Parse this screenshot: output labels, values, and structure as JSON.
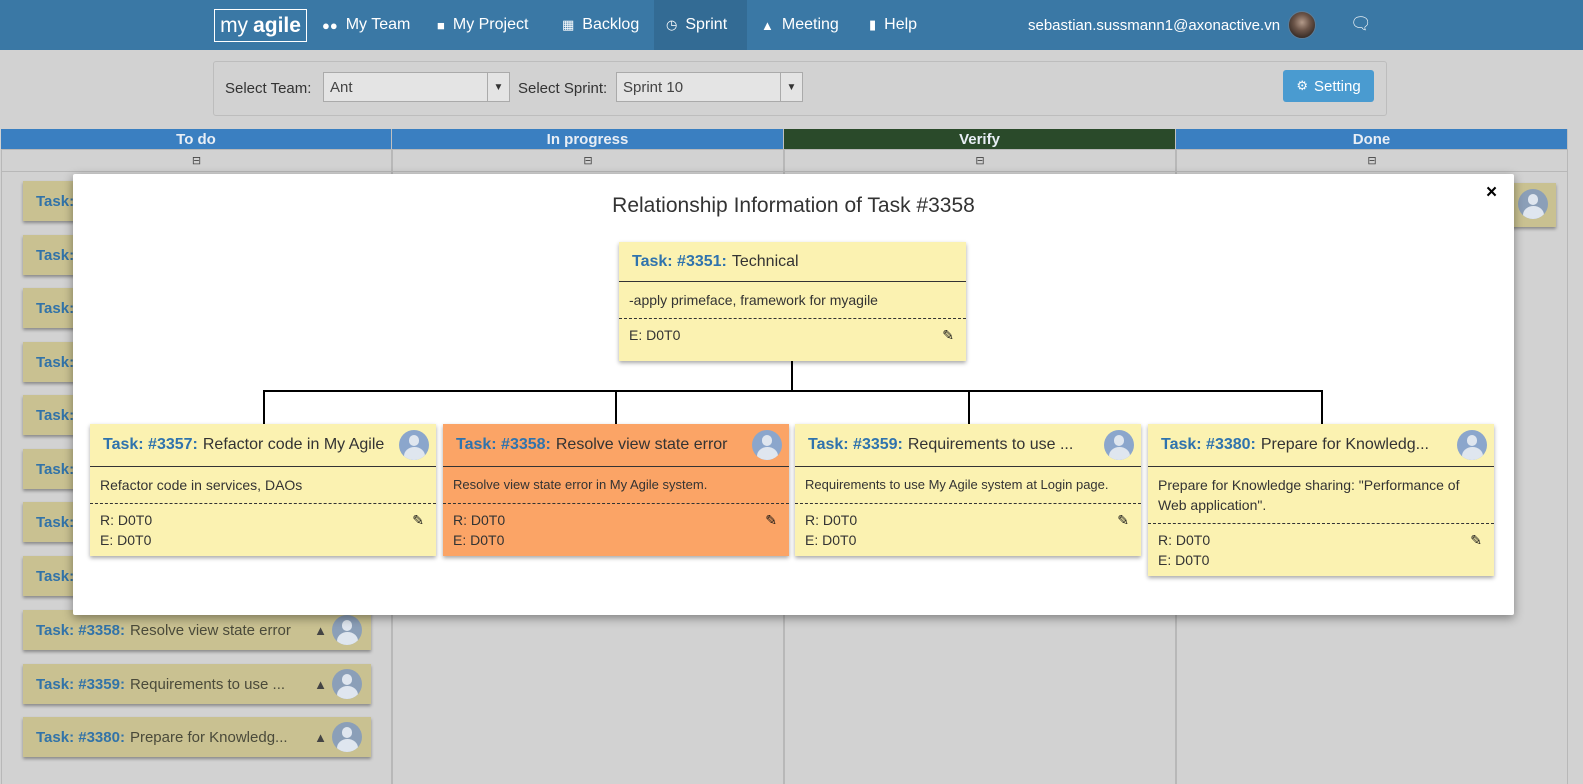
{
  "navbar": {
    "logo_my": "my",
    "logo_agile": "agile",
    "items": [
      {
        "label": "My Team",
        "icon": "users-icon"
      },
      {
        "label": "My Project",
        "icon": "folder-icon"
      },
      {
        "label": "Backlog",
        "icon": "grid-icon"
      },
      {
        "label": "Sprint",
        "icon": "clock-icon",
        "active": true
      },
      {
        "label": "Meeting",
        "icon": "sitemap-icon"
      },
      {
        "label": "Help",
        "icon": "book-icon"
      }
    ],
    "user_email": "sebastian.sussmann1@axonactive.vn"
  },
  "filters": {
    "team_label": "Select Team:",
    "team_value": "Ant",
    "sprint_label": "Select Sprint:",
    "sprint_value": "Sprint 10",
    "setting_label": "Setting"
  },
  "board": {
    "columns": [
      {
        "title": "To do",
        "color": "#3a7fc1"
      },
      {
        "title": "In progress",
        "color": "#3a7fc1"
      },
      {
        "title": "Verify",
        "color": "#2a4a2a"
      },
      {
        "title": "Done",
        "color": "#3a7fc1"
      }
    ],
    "collapse_symbol": "⊟",
    "todo_cards": [
      {
        "id": "Task:",
        "title": ""
      },
      {
        "id": "Task:",
        "title": ""
      },
      {
        "id": "Task:",
        "title": ""
      },
      {
        "id": "Task:",
        "title": ""
      },
      {
        "id": "Task:",
        "title": ""
      },
      {
        "id": "Task:",
        "title": ""
      },
      {
        "id": "Task:",
        "title": ""
      },
      {
        "id": "Task:",
        "title": ""
      },
      {
        "id": "Task: #3358:",
        "title": "Resolve view state error"
      },
      {
        "id": "Task: #3359:",
        "title": "Requirements to use ..."
      },
      {
        "id": "Task: #3380:",
        "title": "Prepare for Knowledg..."
      }
    ]
  },
  "modal": {
    "title": "Relationship Information of Task #3358",
    "close": "×",
    "parent": {
      "id": "Task: #3351:",
      "title": "Technical",
      "description": "-apply primeface, framework for myagile",
      "estimate": "E: D0T0"
    },
    "children": [
      {
        "id": "Task: #3357:",
        "title": "Refactor code in My Agile",
        "description": "Refactor code in services, DAOs",
        "remaining": "R: D0T0",
        "estimate": "E: D0T0"
      },
      {
        "id": "Task: #3358:",
        "title": "Resolve view state error",
        "description": "Resolve view state error in My Agile system.",
        "remaining": "R: D0T0",
        "estimate": "E: D0T0",
        "current": true
      },
      {
        "id": "Task: #3359:",
        "title": "Requirements to use ...",
        "description": "Requirements to use My Agile system at Login page.",
        "remaining": "R: D0T0",
        "estimate": "E: D0T0"
      },
      {
        "id": "Task: #3380:",
        "title": "Prepare for Knowledg...",
        "description": "Prepare for Knowledge sharing: \"Performance of Web application\".",
        "remaining": "R: D0T0",
        "estimate": "E: D0T0"
      }
    ]
  },
  "colors": {
    "navbar": "#3a78a5",
    "task_link": "#2f73ad",
    "card_yellow": "#fbf2b1",
    "card_current": "#fba466"
  }
}
